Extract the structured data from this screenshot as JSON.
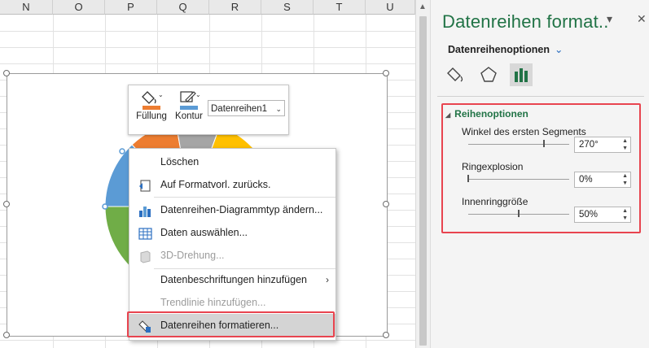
{
  "spreadsheet": {
    "columns": [
      "N",
      "O",
      "P",
      "Q",
      "R",
      "S",
      "T",
      "U"
    ],
    "pie_colors": [
      "#ed7d31",
      "#a5a5a5",
      "#ffc000",
      "#5b9bd5",
      "#70ad47"
    ]
  },
  "mini_toolbar": {
    "fill_label": "Füllung",
    "outline_label": "Kontur",
    "series_select": "Datenreihen1"
  },
  "context_menu": {
    "items": [
      {
        "label": "Löschen",
        "icon": "delete-icon",
        "enabled": true
      },
      {
        "label": "Auf Formatvorl. zurücks.",
        "icon": "reset-style-icon",
        "enabled": true
      },
      {
        "label": "Datenreihen-Diagrammtyp ändern...",
        "icon": "chart-type-icon",
        "enabled": true
      },
      {
        "label": "Daten auswählen...",
        "icon": "select-data-icon",
        "enabled": true
      },
      {
        "label": "3D-Drehung...",
        "icon": "3d-rotation-icon",
        "enabled": false
      },
      {
        "label": "Datenbeschriftungen hinzufügen",
        "icon": "",
        "enabled": true,
        "submenu": true
      },
      {
        "label": "Trendlinie hinzufügen...",
        "icon": "",
        "enabled": false
      },
      {
        "label": "Datenreihen formatieren...",
        "icon": "format-series-icon",
        "enabled": true,
        "highlighted": true
      }
    ]
  },
  "format_pane": {
    "title": "Datenreihen format..",
    "subtitle": "Datenreihenoptionen",
    "section": "Reihenoptionen",
    "options": [
      {
        "label": "Winkel des ersten Segments",
        "value": "270°",
        "slider_fraction": 0.75
      },
      {
        "label": "Ringexplosion",
        "value": "0%",
        "slider_fraction": 0.0
      },
      {
        "label": "Innenringgröße",
        "value": "50%",
        "slider_fraction": 0.5
      }
    ],
    "accent_color": "#217346",
    "highlight_color": "#e8444f"
  }
}
